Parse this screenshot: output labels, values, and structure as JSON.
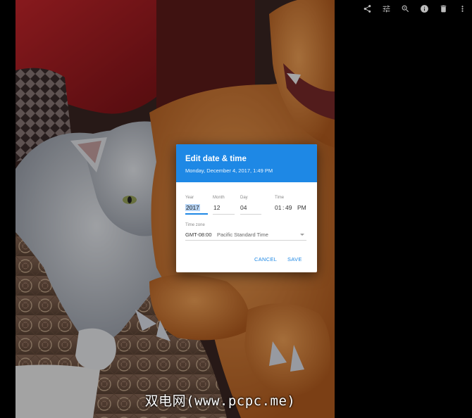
{
  "toolbar": {
    "icons": [
      "share-icon",
      "tune-icon",
      "zoom-in-icon",
      "info-icon",
      "delete-icon",
      "more-vert-icon"
    ],
    "icon_color": "#bdbdbd"
  },
  "dialog": {
    "title": "Edit date & time",
    "subtitle": "Monday, December 4, 2017, 1:49 PM",
    "header_color": "#1e88e5",
    "fields": {
      "year_label": "Year",
      "year_value": "2017",
      "month_label": "Month",
      "month_value": "12",
      "day_label": "Day",
      "day_value": "04",
      "time_label": "Time",
      "hour_value": "01",
      "time_separator": ":",
      "minute_value": "49",
      "ampm_value": "PM",
      "timezone_label": "Time zone",
      "timezone_offset": "GMT-08:00",
      "timezone_name": "Pacific Standard Time"
    },
    "buttons": {
      "cancel": "CANCEL",
      "save": "SAVE"
    }
  },
  "watermark": "双电网(www.pcpc.me)"
}
